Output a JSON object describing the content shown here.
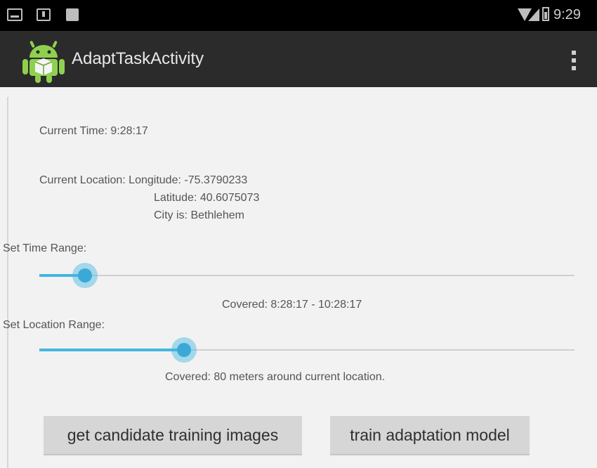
{
  "status_bar": {
    "time": "9:29",
    "icons": [
      "notification-icon",
      "download-notification-icon",
      "image-notification-icon",
      "wifi-icon",
      "signal-icon",
      "battery-icon"
    ]
  },
  "action_bar": {
    "title": "AdaptTaskActivity",
    "app_icon": "android-robot-icon",
    "overflow_icon": "overflow-menu-icon",
    "color": "#2b2b2b"
  },
  "info": {
    "current_time_label": "Current Time:  9:28:17",
    "current_location_label": "Current Location: Longitude: -75.3790233",
    "latitude_label": "Latitude: 40.6075073",
    "city_label": "City is: Bethlehem"
  },
  "time_range": {
    "label": "Set Time Range:",
    "slider_value": 0.085,
    "covered_text": "Covered: 8:28:17 - 10:28:17"
  },
  "location_range": {
    "label": "Set Location Range:",
    "slider_value": 0.27,
    "covered_text": "Covered: 80 meters around current location."
  },
  "buttons": {
    "candidate_label": "get candidate training images",
    "train_label": "train adaptation model"
  },
  "colors": {
    "accent": "#45b5e1",
    "background": "#f2f2f2",
    "button": "#d6d6d6"
  }
}
